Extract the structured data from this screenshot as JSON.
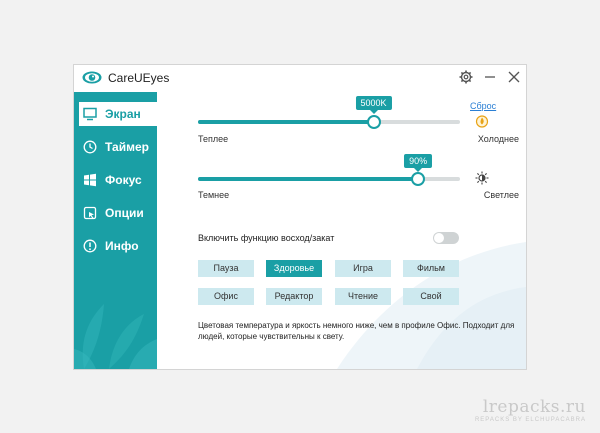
{
  "window": {
    "title": "CareUEyes"
  },
  "titlebar_icons": [
    "gear-icon",
    "minimize-icon",
    "close-icon"
  ],
  "sidebar": {
    "items": [
      {
        "label": "Экран",
        "icon": "monitor-icon",
        "active": true
      },
      {
        "label": "Таймер",
        "icon": "clock-icon",
        "active": false
      },
      {
        "label": "Фокус",
        "icon": "windows-icon",
        "active": false
      },
      {
        "label": "Опции",
        "icon": "options-icon",
        "active": false
      },
      {
        "label": "Инфо",
        "icon": "info-icon",
        "active": false
      }
    ]
  },
  "screen": {
    "reset_label": "Сброс",
    "temperature": {
      "value_label": "5000K",
      "level": 0.67,
      "left_label": "Теплее",
      "right_label": "Холоднее",
      "icon": "flame-icon"
    },
    "brightness": {
      "value_label": "90%",
      "level": 0.84,
      "left_label": "Темнее",
      "right_label": "Светлее",
      "icon": "sun-icon"
    },
    "sunrise_toggle": {
      "label": "Включить функцию восход/закат",
      "on": false
    },
    "presets": [
      {
        "label": "Пауза",
        "selected": false
      },
      {
        "label": "Здоровье",
        "selected": true
      },
      {
        "label": "Игра",
        "selected": false
      },
      {
        "label": "Фильм",
        "selected": false
      },
      {
        "label": "Офис",
        "selected": false
      },
      {
        "label": "Редактор",
        "selected": false
      },
      {
        "label": "Чтение",
        "selected": false
      },
      {
        "label": "Свой",
        "selected": false
      }
    ],
    "description": "Цветовая температура и яркость немного ниже, чем в профиле Офис. Подходит для людей, которые чувствительны к свету."
  },
  "watermark": {
    "main": "lrepacks.ru",
    "sub": "REPACKS BY ELCHUPACABRA"
  },
  "colors": {
    "accent": "#1a9fa5",
    "preset_bg": "#cde9ef",
    "link": "#2a7fd4"
  }
}
